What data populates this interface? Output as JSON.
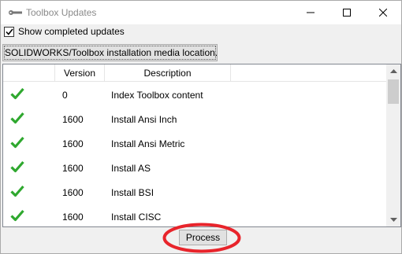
{
  "window": {
    "title": "Toolbox Updates"
  },
  "options": {
    "show_completed_label": "Show completed updates",
    "show_completed_checked": true
  },
  "media_button": {
    "label": "SOLIDWORKS/Toolbox installation media location..."
  },
  "table": {
    "columns": [
      "",
      "Version",
      "Description"
    ],
    "rows": [
      {
        "status_icon": "green-checkmark",
        "version": "0",
        "description": "Index Toolbox content"
      },
      {
        "status_icon": "green-checkmark",
        "version": "1600",
        "description": "Install Ansi Inch"
      },
      {
        "status_icon": "green-checkmark",
        "version": "1600",
        "description": "Install Ansi Metric"
      },
      {
        "status_icon": "green-checkmark",
        "version": "1600",
        "description": "Install AS"
      },
      {
        "status_icon": "green-checkmark",
        "version": "1600",
        "description": "Install BSI"
      },
      {
        "status_icon": "green-checkmark",
        "version": "1600",
        "description": "Install CISC"
      }
    ]
  },
  "process_button": {
    "label": "Process"
  },
  "colors": {
    "check_green": "#2fa82f",
    "highlight_red": "#e8242b"
  }
}
